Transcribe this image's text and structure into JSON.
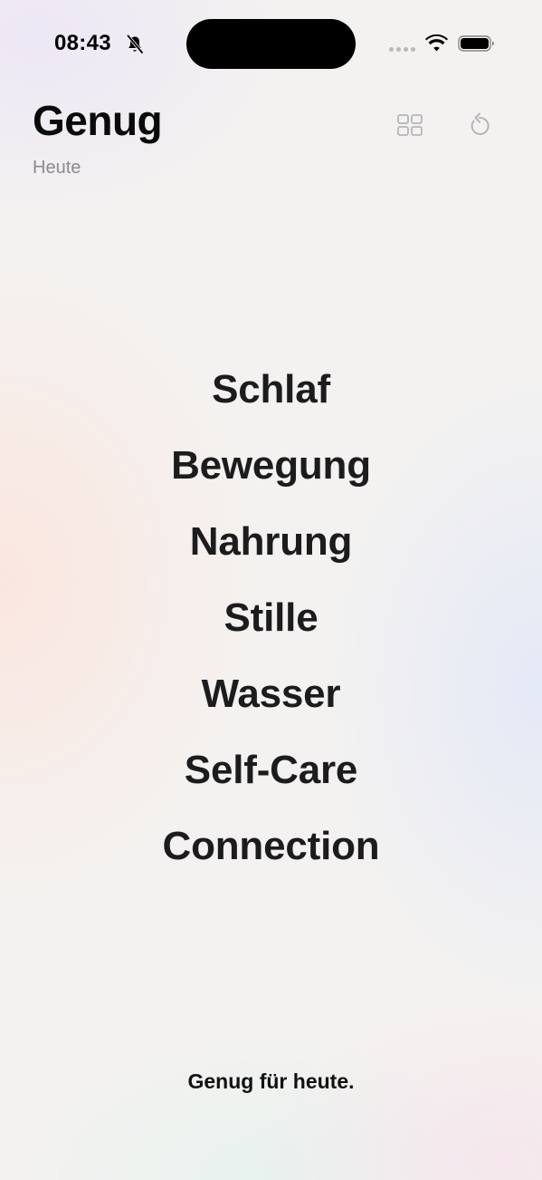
{
  "status_bar": {
    "time": "08:43",
    "icons": [
      "bell-slash-icon",
      "cellular-signal-icon",
      "wifi-icon",
      "battery-icon"
    ]
  },
  "header": {
    "title": "Genug",
    "subtitle": "Heute",
    "actions": [
      {
        "name": "grid-view",
        "icon": "grid-icon"
      },
      {
        "name": "reset",
        "icon": "reset-icon"
      }
    ]
  },
  "categories": [
    {
      "label": "Schlaf"
    },
    {
      "label": "Bewegung"
    },
    {
      "label": "Nahrung"
    },
    {
      "label": "Stille"
    },
    {
      "label": "Wasser"
    },
    {
      "label": "Self-Care"
    },
    {
      "label": "Connection"
    }
  ],
  "footer": {
    "message": "Genug für heute."
  },
  "colors": {
    "text_primary": "#1c1c1e",
    "text_secondary": "#8c8a8c",
    "icon_muted": "#b5b5ba"
  }
}
